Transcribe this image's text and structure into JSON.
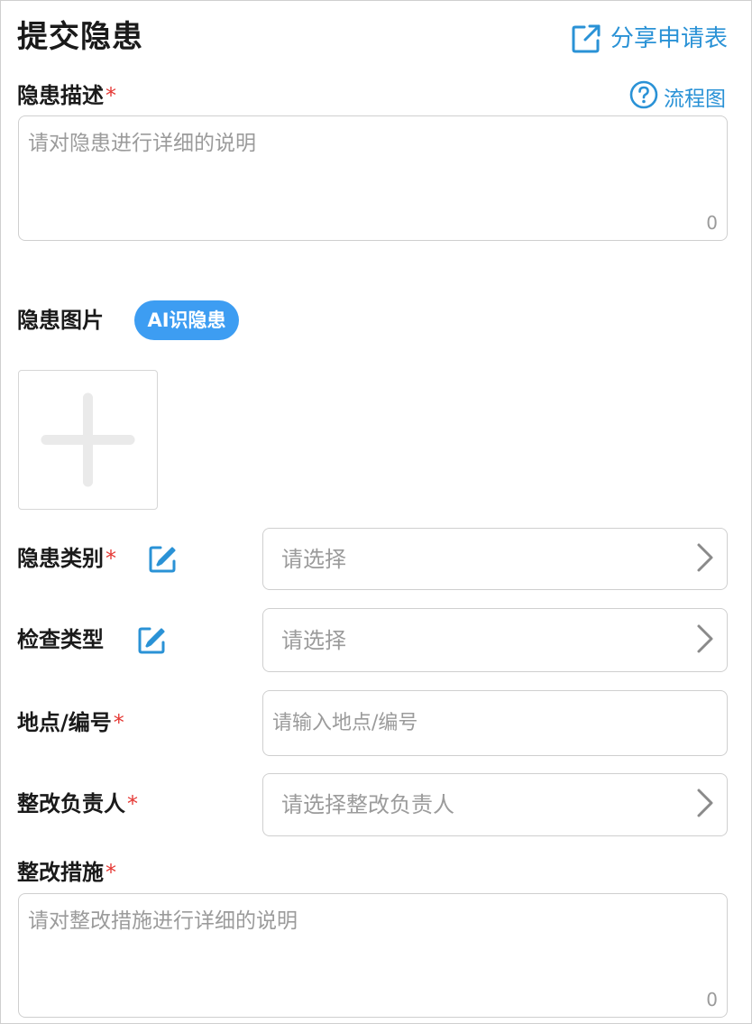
{
  "header": {
    "title": "提交隐患",
    "share_label": "分享申请表",
    "share_icon": "external-link-icon"
  },
  "colors": {
    "accent": "#2a92d6",
    "badge": "#3d9df2",
    "required": "#e53935",
    "placeholder": "#9b9b9b",
    "border": "#cfcfcf"
  },
  "hazard_description": {
    "label": "隐患描述",
    "required_mark": "*",
    "flow_label": "流程图",
    "flow_icon": "help-circle-icon",
    "placeholder": "请对隐患进行详细的说明",
    "char_count": "0"
  },
  "hazard_photos": {
    "label": "隐患图片",
    "ai_button": "AI识隐患",
    "add_icon": "plus-icon"
  },
  "hazard_category": {
    "label": "隐患类别",
    "required_mark": "*",
    "placeholder": "请选择",
    "edit_icon": "edit-icon",
    "chevron_icon": "chevron-right-icon"
  },
  "inspection_type": {
    "label": "检查类型",
    "placeholder": "请选择",
    "edit_icon": "edit-icon",
    "chevron_icon": "chevron-right-icon"
  },
  "location": {
    "label": "地点/编号",
    "required_mark": "*",
    "placeholder": "请输入地点/编号"
  },
  "rectification_owner": {
    "label": "整改负责人",
    "required_mark": "*",
    "placeholder": "请选择整改负责人",
    "chevron_icon": "chevron-right-icon"
  },
  "rectification_measures": {
    "label": "整改措施",
    "required_mark": "*",
    "placeholder": "请对整改措施进行详细的说明",
    "char_count": "0"
  }
}
